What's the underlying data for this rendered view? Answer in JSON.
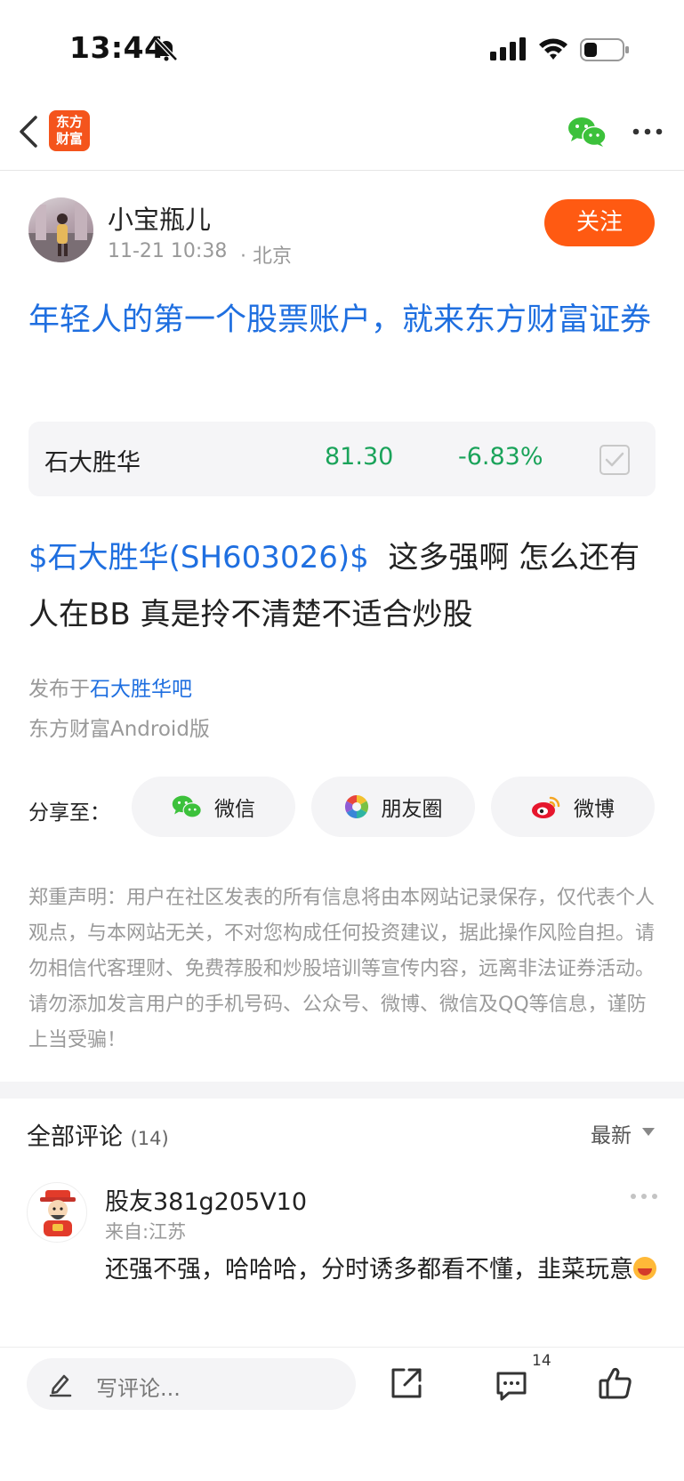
{
  "status_bar": {
    "time": "13:44"
  },
  "nav": {
    "logo_line1": "东方",
    "logo_line2": "财富"
  },
  "author": {
    "name": "小宝瓶儿",
    "time": "11-21 10:38",
    "location": "· 北京",
    "follow_label": "关注"
  },
  "post": {
    "title": "年轻人的第一个股票账户，就来东方财富证券",
    "stock": {
      "name": "石大胜华",
      "price": "81.30",
      "change": "-6.83%"
    },
    "body_tag": "$石大胜华(SH603026)$",
    "body_text": "这多强啊 怎么还有人在BB 真是拎不清楚不适合炒股",
    "published_prefix": "发布于",
    "published_bar": "石大胜华吧",
    "client": "东方财富Android版"
  },
  "share": {
    "label": "分享至：",
    "wechat": "微信",
    "moments": "朋友圈",
    "weibo": "微博"
  },
  "disclaimer": "郑重声明：用户在社区发表的所有信息将由本网站记录保存，仅代表个人观点，与本网站无关，不对您构成任何投资建议，据此操作风险自担。请勿相信代客理财、免费荐股和炒股培训等宣传内容，远离非法证券活动。请勿添加发言用户的手机号码、公众号、微博、微信及QQ等信息，谨防上当受骗！",
  "comments": {
    "title": "全部评论",
    "count": "(14)",
    "sort": "最新",
    "items": [
      {
        "name": "股友381g205V10",
        "from": "来自:江苏",
        "text": "还强不强，哈哈哈，分时诱多都看不懂，韭菜玩意"
      }
    ]
  },
  "bottom_bar": {
    "placeholder": "写评论...",
    "comment_count": "14"
  },
  "colors": {
    "accent": "#ff5a12",
    "link": "#1f6fe0",
    "down": "#1aa35a"
  }
}
